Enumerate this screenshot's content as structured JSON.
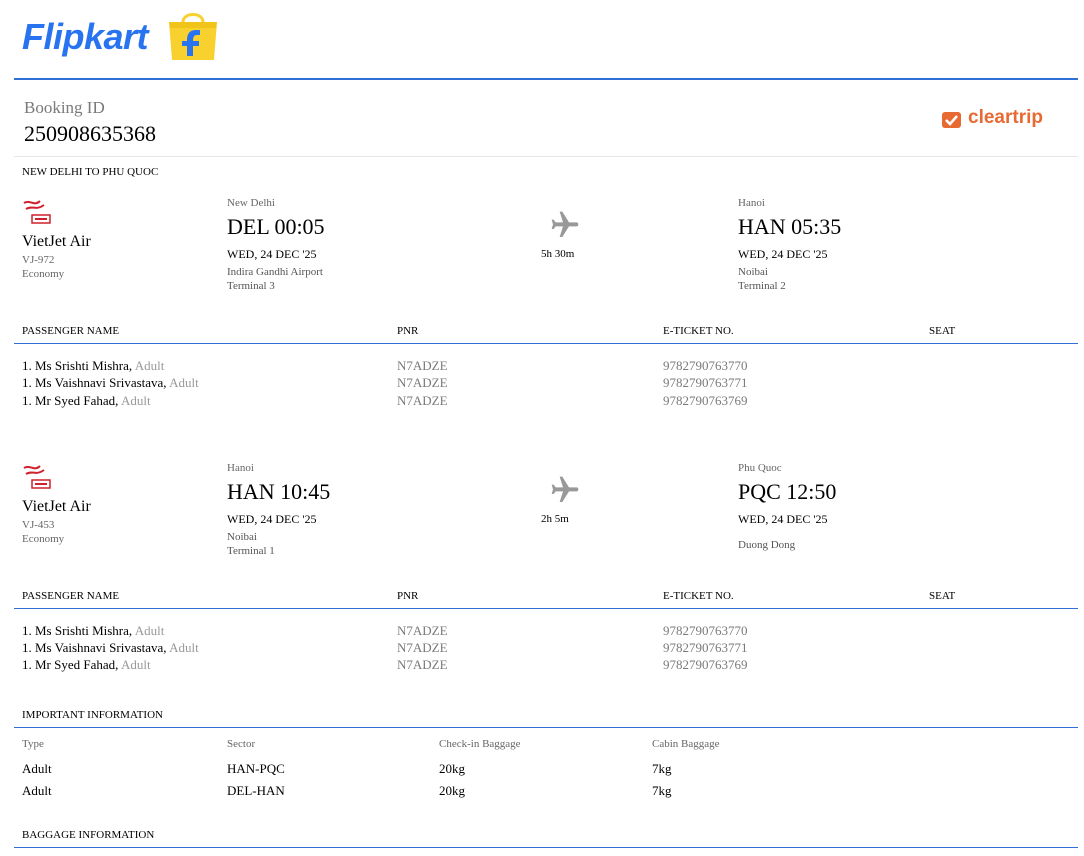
{
  "header": {
    "brand": "Flipkart",
    "booking_id_label": "Booking ID",
    "booking_id": "250908635368",
    "partner": "cleartrip"
  },
  "colors": {
    "accent": "#2f6fd6",
    "flipkart_blue": "#2874f0",
    "flipkart_yellow": "#f8d12f",
    "cleartrip_orange": "#e86a33",
    "vietjet_red": "#d0202d"
  },
  "trip": {
    "title": "NEW DELHI TO PHU QUOC"
  },
  "segments": [
    {
      "airline": "VietJet Air",
      "flight_no": "VJ-972",
      "cabin": "Economy",
      "dep": {
        "city": "New Delhi",
        "code_time": "DEL 00:05",
        "date": "WED, 24 DEC '25",
        "airport": "Indira Gandhi Airport",
        "terminal": "Terminal 3"
      },
      "duration": "5h 30m",
      "arr": {
        "city": "Hanoi",
        "code_time": "HAN 05:35",
        "date": "WED, 24 DEC '25",
        "airport": "Noibai",
        "terminal": "Terminal 2"
      },
      "passengers": [
        {
          "name": "1. Ms Srishti Mishra,",
          "type": "Adult",
          "pnr": "N7ADZE",
          "eticket": "9782790763770",
          "seat": ""
        },
        {
          "name": "1. Ms Vaishnavi Srivastava,",
          "type": "Adult",
          "pnr": "N7ADZE",
          "eticket": "9782790763771",
          "seat": ""
        },
        {
          "name": "1. Mr Syed Fahad,",
          "type": "Adult",
          "pnr": "N7ADZE",
          "eticket": "9782790763769",
          "seat": ""
        }
      ]
    },
    {
      "airline": "VietJet Air",
      "flight_no": "VJ-453",
      "cabin": "Economy",
      "dep": {
        "city": "Hanoi",
        "code_time": "HAN 10:45",
        "date": "WED, 24 DEC '25",
        "airport": "Noibai",
        "terminal": "Terminal 1"
      },
      "duration": "2h 5m",
      "arr": {
        "city": "Phu Quoc",
        "code_time": "PQC 12:50",
        "date": "WED, 24 DEC '25",
        "airport": "Duong Dong",
        "terminal": ""
      },
      "passengers": [
        {
          "name": "1. Ms Srishti Mishra,",
          "type": "Adult",
          "pnr": "N7ADZE",
          "eticket": "9782790763770",
          "seat": ""
        },
        {
          "name": "1. Ms Vaishnavi Srivastava,",
          "type": "Adult",
          "pnr": "N7ADZE",
          "eticket": "9782790763771",
          "seat": ""
        },
        {
          "name": "1. Mr Syed Fahad,",
          "type": "Adult",
          "pnr": "N7ADZE",
          "eticket": "9782790763769",
          "seat": ""
        }
      ]
    }
  ],
  "passenger_table_headers": {
    "name": "PASSENGER NAME",
    "pnr": "PNR",
    "eticket": "E-TICKET NO.",
    "seat": "SEAT"
  },
  "important_info": {
    "title": "IMPORTANT INFORMATION",
    "headers": {
      "type": "Type",
      "sector": "Sector",
      "checkin": "Check-in Baggage",
      "cabin": "Cabin Baggage"
    },
    "rows": [
      {
        "type": "Adult",
        "sector": "HAN-PQC",
        "checkin": "20kg",
        "cabin": "7kg"
      },
      {
        "type": "Adult",
        "sector": "DEL-HAN",
        "checkin": "20kg",
        "cabin": "7kg"
      }
    ]
  },
  "baggage_info": {
    "title": "BAGGAGE INFORMATION"
  }
}
